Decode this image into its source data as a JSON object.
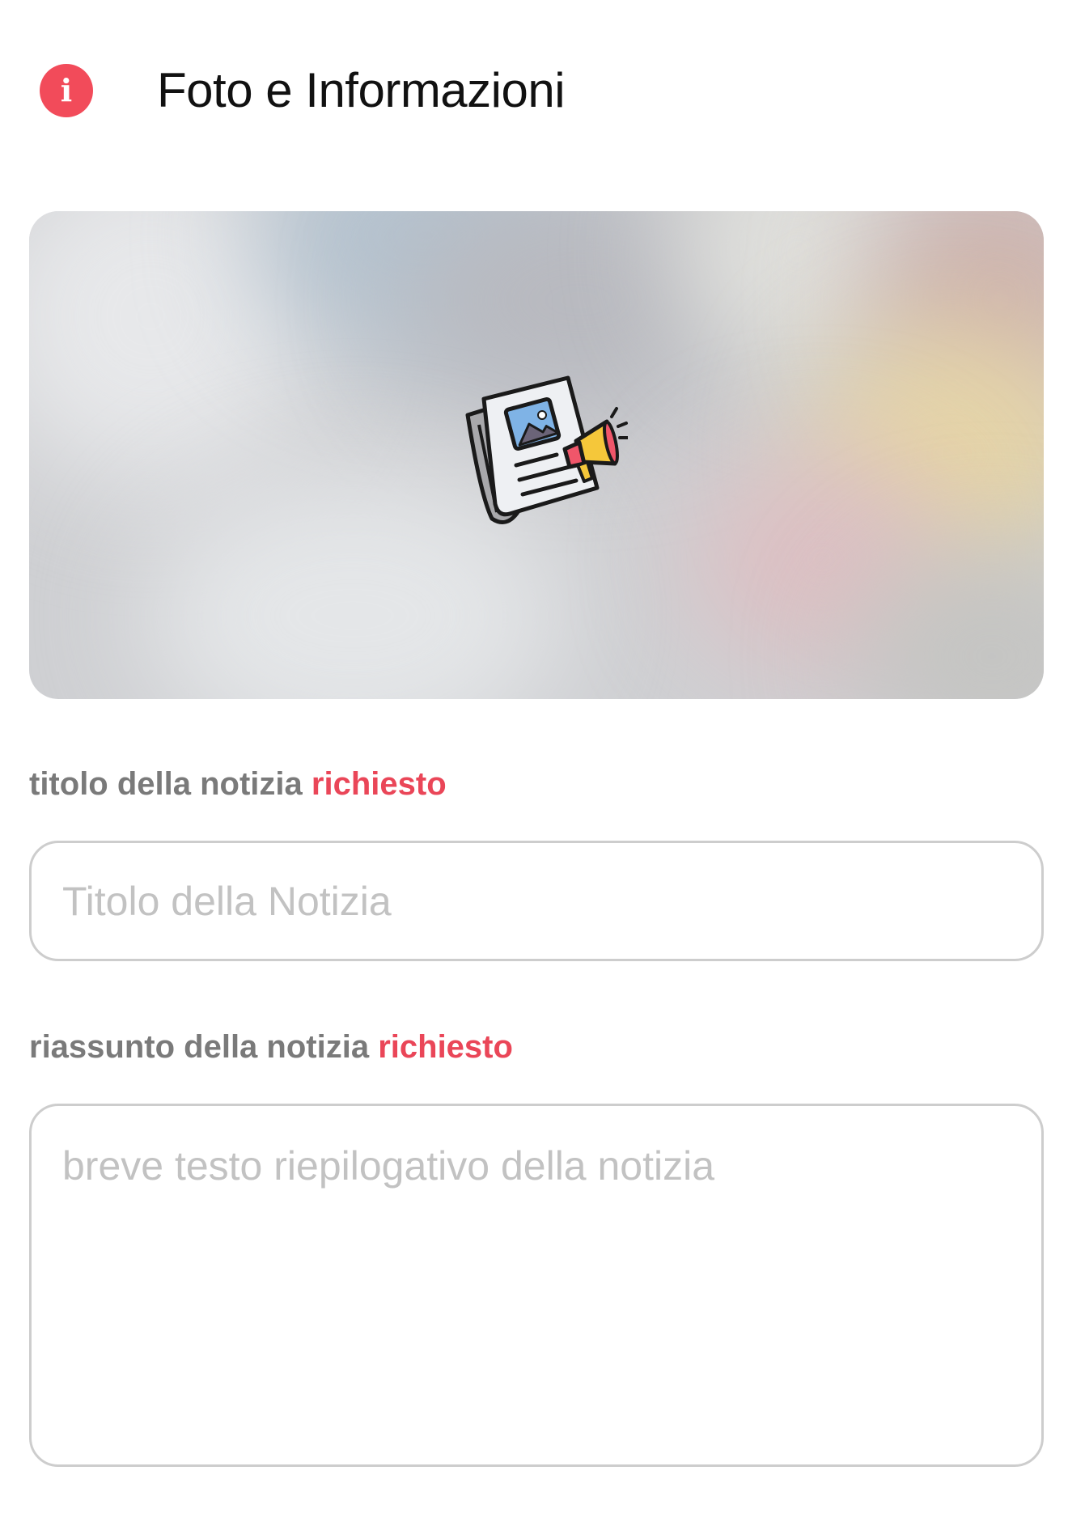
{
  "header": {
    "info_icon": "info-icon",
    "info_glyph": "i",
    "title": "Foto e Informazioni"
  },
  "photo": {
    "icon": "newspaper-megaphone-icon"
  },
  "form": {
    "title_field": {
      "label": "titolo della notizia",
      "required": "richiesto",
      "placeholder": "Titolo della Notizia",
      "value": ""
    },
    "summary_field": {
      "label": "riassunto della notizia",
      "required": "richiesto",
      "placeholder": "breve testo riepilogativo della notizia",
      "value": ""
    }
  },
  "colors": {
    "accent": "#f24b5a",
    "required": "#ea4658",
    "label": "#7a7a7a",
    "border": "#cdcdcd",
    "placeholder": "#c2c2c2"
  }
}
